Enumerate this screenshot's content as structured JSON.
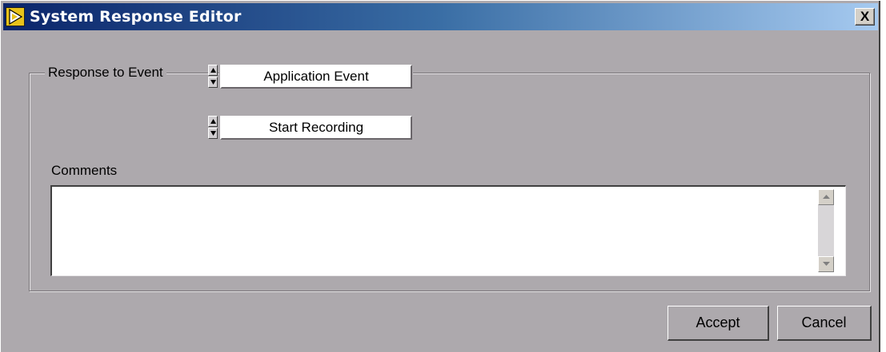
{
  "window": {
    "title": "System Response Editor",
    "close_label": "X",
    "icon": "labview-run-icon"
  },
  "group": {
    "label": "Response to Event"
  },
  "event_type": {
    "value": "Application Event",
    "icon": "up-down-stepper-icon"
  },
  "event_action": {
    "value": "Start Recording",
    "icon": "up-down-stepper-icon"
  },
  "comments": {
    "label": "Comments",
    "value": ""
  },
  "buttons": {
    "accept_label": "Accept",
    "cancel_label": "Cancel"
  },
  "colors": {
    "title_start": "#0a246a",
    "title_end": "#a6caf0",
    "panel": "#ada9ad"
  }
}
